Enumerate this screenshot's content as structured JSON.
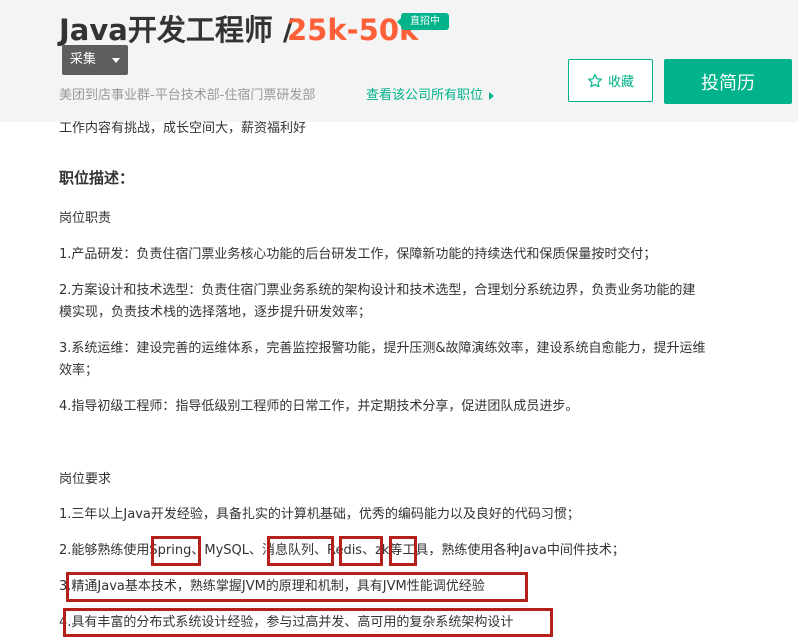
{
  "header": {
    "title": "Java开发工程师 /",
    "salary": "25k-50k",
    "badge": "直招中",
    "collect_dropdown": "采集",
    "company_dept": "美团到店事业群-平台技术部-住宿门票研发部",
    "all_jobs_link": "查看该公司所有职位",
    "favorite_label": "收藏",
    "apply_label": "投简历"
  },
  "colors": {
    "accent": "#00b38a",
    "salary": "#fd5f39",
    "highlight_box": "#b3211a"
  },
  "body": {
    "advantage": "工作内容有挑战，成长空间大，薪资福利好",
    "section_title": "职位描述：",
    "duties_heading": "岗位职责",
    "duties": [
      "1.产品研发：负责住宿门票业务核心功能的后台研发工作，保障新功能的持续迭代和保质保量按时交付；",
      "2.方案设计和技术选型：负责住宿门票业务系统的架构设计和技术选型，合理划分系统边界，负责业务功能的建",
      "模实现，负责技术栈的选择落地，逐步提升研发效率；",
      "3.系统运维：建设完善的运维体系，完善监控报警功能，提升压测&故障演练效率，建设系统自愈能力，提升运维",
      "效率；",
      "4.指导初级工程师：指导低级别工程师的日常工作，并定期技术分享，促进团队成员进步。"
    ],
    "requirements_heading": "岗位要求",
    "requirements": [
      "1.三年以上Java开发经验，具备扎实的计算机基础，优秀的编码能力以及良好的代码习惯；",
      "2.能够熟练使用Spring、MySQL、消息队列、Redis、zk等工具，熟练使用各种Java中间件技术；",
      "3.精通Java基本技术，熟练掌握JVM的原理和机制，具有JVM性能调优经验",
      "4.具有丰富的分布式系统设计经验，参与过高并发、高可用的复杂系统架构设计"
    ]
  }
}
